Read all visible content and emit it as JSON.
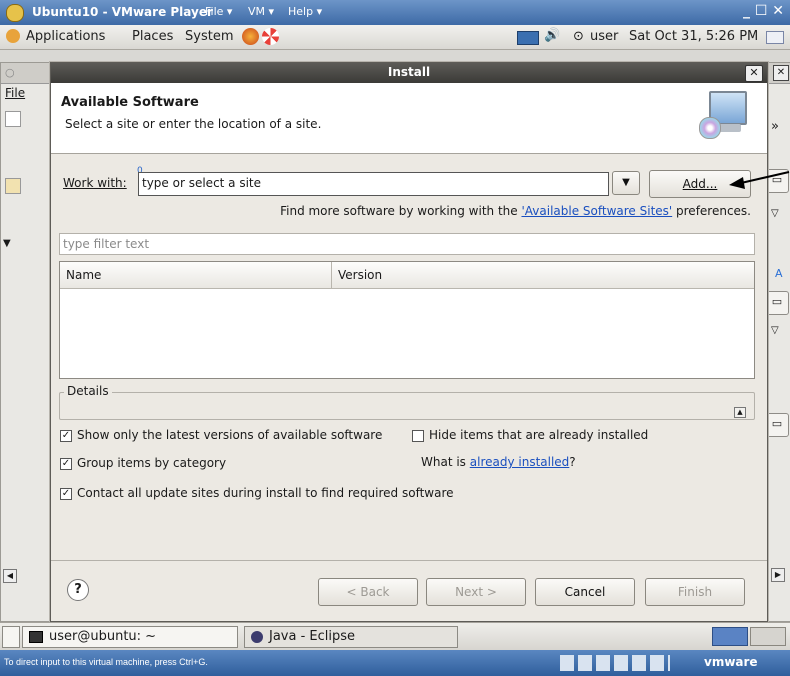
{
  "vmware": {
    "title": "Ubuntu10 - VMware Player",
    "menus": [
      "File ▾",
      "VM ▾",
      "Help ▾"
    ],
    "status_hint": "To direct input to this virtual machine, press Ctrl+G.",
    "brand": "vmware"
  },
  "gnome": {
    "menus": [
      "Applications",
      "Places",
      "System"
    ],
    "user": "user",
    "clock": "Sat Oct 31, 5:26 PM"
  },
  "eclipse": {
    "menu_file": "File",
    "side_chevron": "»"
  },
  "dialog": {
    "title": "Install",
    "header_title": "Available Software",
    "header_desc": "Select a site or enter the location of a site.",
    "work_with_label": "Work with:",
    "work_with_placeholder": "type or select a site",
    "add_button": "Add...",
    "find_more_prefix": "Find more software by working with the ",
    "find_more_link": "'Available Software Sites'",
    "find_more_suffix": " preferences.",
    "filter_placeholder": "type filter text",
    "columns": [
      "Name",
      "Version"
    ],
    "details_label": "Details",
    "options": {
      "latest_versions": {
        "label": "Show only the latest versions of available software",
        "checked": true
      },
      "hide_installed": {
        "label": "Hide items that are already installed",
        "checked": false
      },
      "group_by_category": {
        "label": "Group items by category",
        "checked": true
      },
      "contact_sites": {
        "label": "Contact all update sites during install to find required software",
        "checked": true
      }
    },
    "what_is_prefix": "What is ",
    "what_is_link": "already installed",
    "what_is_suffix": "?",
    "help_icon": "?",
    "buttons": {
      "back": "< Back",
      "next": "Next >",
      "cancel": "Cancel",
      "finish": "Finish"
    }
  },
  "taskbar": {
    "items": [
      "user@ubuntu: ~",
      "Java - Eclipse"
    ]
  }
}
